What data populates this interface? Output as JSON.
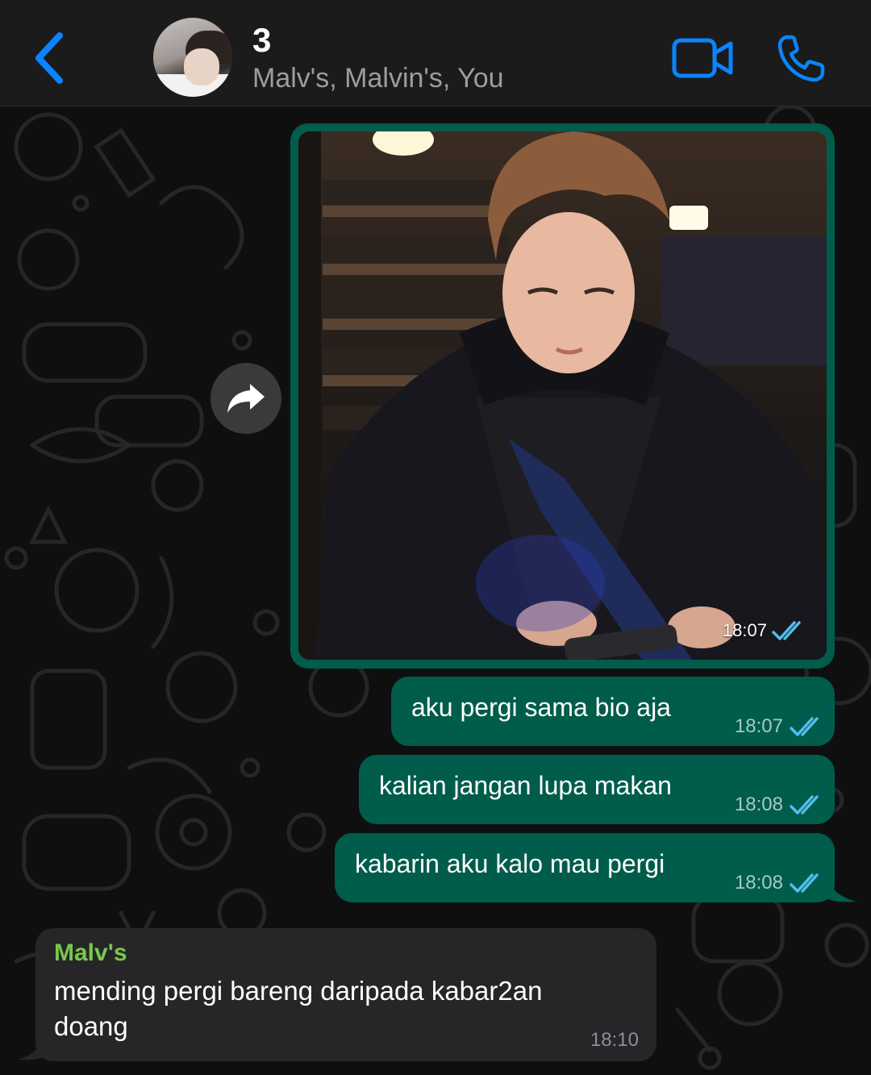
{
  "header": {
    "title": "3",
    "subtitle": "Malv's, Malvin's, You"
  },
  "icons": {
    "back": "chevron-left-icon",
    "video": "video-camera-icon",
    "call": "phone-icon",
    "forward": "forward-icon",
    "read": "double-check-icon"
  },
  "colors": {
    "accent": "#0a84ff",
    "outgoing_bubble": "#005c4b",
    "incoming_bubble": "#262628",
    "sender_name": "#79c74a",
    "read_ticks": "#53bdeb"
  },
  "messages": {
    "image": {
      "time": "18:07",
      "status": "read"
    },
    "out1": {
      "text": "aku pergi sama bio aja",
      "time": "18:07",
      "status": "read"
    },
    "out2": {
      "text": "kalian jangan lupa makan",
      "time": "18:08",
      "status": "read"
    },
    "out3": {
      "text": "kabarin aku kalo mau pergi",
      "time": "18:08",
      "status": "read"
    },
    "in1": {
      "sender": "Malv's",
      "text": "mending pergi bareng daripada kabar2an doang",
      "time": "18:10"
    }
  }
}
